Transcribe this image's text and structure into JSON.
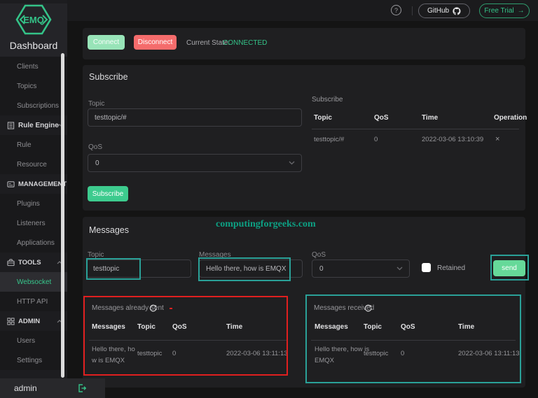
{
  "brand": {
    "logo_text": "EMQ",
    "app_title": "Dashboard"
  },
  "topbar": {
    "help_symbol": "?",
    "github_label": "GitHub",
    "free_trial_label": "Free Trial",
    "arrow": "→"
  },
  "sidebar": {
    "items": [
      {
        "label": "Clients"
      },
      {
        "label": "Topics"
      },
      {
        "label": "Subscriptions"
      },
      {
        "label": "Rule Engine"
      },
      {
        "label": "Rule"
      },
      {
        "label": "Resource"
      },
      {
        "label": "MANAGEMENT"
      },
      {
        "label": "Plugins"
      },
      {
        "label": "Listeners"
      },
      {
        "label": "Applications"
      },
      {
        "label": "TOOLS"
      },
      {
        "label": "Websocket"
      },
      {
        "label": "HTTP API"
      },
      {
        "label": "ADMIN"
      },
      {
        "label": "Users"
      },
      {
        "label": "Settings"
      }
    ],
    "footer_username": "admin"
  },
  "connection": {
    "connect": "Connect",
    "disconnect": "Disconnect",
    "state_label": "Current State:",
    "state_value": "CONNECTED"
  },
  "subscribe": {
    "title": "Subscribe",
    "topic_label": "Topic",
    "topic_value": "testtopic/#",
    "qos_label": "QoS",
    "qos_value": "0",
    "button": "Subscribe",
    "table_caption": "Subscribe",
    "headers": {
      "topic": "Topic",
      "qos": "QoS",
      "time": "Time",
      "operation": "Operation"
    },
    "row": {
      "topic": "testtopic/#",
      "qos": "0",
      "time": "2022-03-06 13:10:39",
      "operation": "×"
    }
  },
  "messages": {
    "title": "Messages",
    "watermark": "computingforgeeks.com",
    "topic_label": "Topic",
    "topic_value": "testtopic",
    "messages_label": "Messages",
    "messages_value": "Hello there, how is EMQX",
    "qos_label": "QoS",
    "qos_value": "0",
    "retained_label": "Retained",
    "send_button": "send",
    "sent": {
      "caption": "Messages already sent",
      "headers": {
        "messages": "Messages",
        "topic": "Topic",
        "qos": "QoS",
        "time": "Time"
      },
      "row": {
        "messages": "Hello there, how is EMQX",
        "topic": "testtopic",
        "qos": "0",
        "time": "2022-03-06 13:11:13"
      }
    },
    "received": {
      "caption": "Messages received",
      "headers": {
        "messages": "Messages",
        "topic": "Topic",
        "qos": "QoS",
        "time": "Time"
      },
      "row": {
        "messages": "Hello there, how is EMQX",
        "topic": "testtopic",
        "qos": "0",
        "time": "2022-03-06 13:11:13"
      }
    }
  },
  "colors": {
    "accent": "#34c388",
    "danger": "#f56c6c",
    "connect_bg": "#98e4b8",
    "send_bg": "#66d999",
    "annotation_red": "#e01f1f",
    "annotation_teal": "#2aa198",
    "watermark": "#0da083",
    "sidebar_bg": "#1d1d20",
    "card_bg": "#1f1f21"
  }
}
